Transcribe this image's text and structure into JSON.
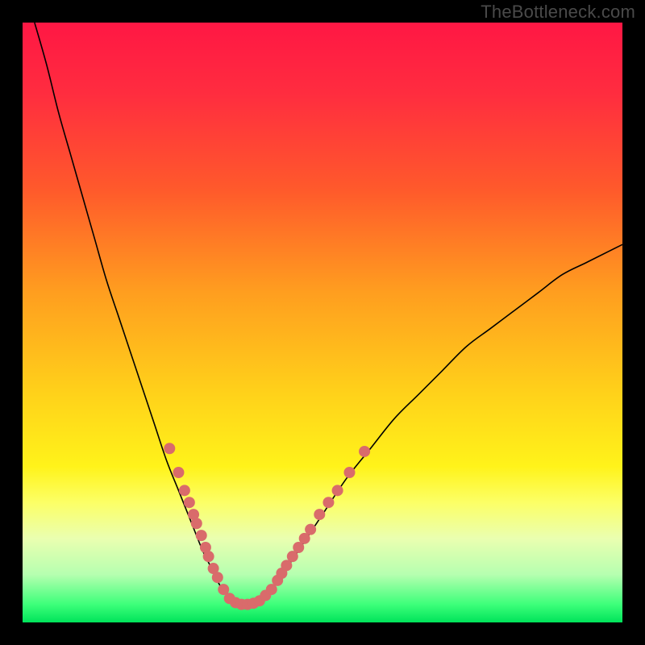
{
  "watermark": "TheBottleneck.com",
  "chart_data": {
    "type": "line",
    "title": "",
    "xlabel": "",
    "ylabel": "",
    "xlim": [
      0,
      100
    ],
    "ylim": [
      0,
      100
    ],
    "background_gradient": {
      "stops": [
        {
          "offset": 0.0,
          "color": "#ff1744"
        },
        {
          "offset": 0.12,
          "color": "#ff2d3f"
        },
        {
          "offset": 0.28,
          "color": "#ff5a2b"
        },
        {
          "offset": 0.45,
          "color": "#ff9e1f"
        },
        {
          "offset": 0.62,
          "color": "#ffd21a"
        },
        {
          "offset": 0.74,
          "color": "#fff31a"
        },
        {
          "offset": 0.8,
          "color": "#fcff66"
        },
        {
          "offset": 0.86,
          "color": "#eaffb0"
        },
        {
          "offset": 0.92,
          "color": "#b6ffb0"
        },
        {
          "offset": 0.97,
          "color": "#3dff7a"
        },
        {
          "offset": 1.0,
          "color": "#00e35a"
        }
      ]
    },
    "series": [
      {
        "name": "curve",
        "stroke": "#000000",
        "stroke_width": 1.6,
        "x": [
          2,
          4,
          6,
          8,
          10,
          12,
          14,
          16,
          18,
          20,
          22,
          24,
          26,
          28,
          30,
          31,
          32,
          33,
          34,
          35,
          36,
          37,
          38,
          39,
          40,
          42,
          44,
          46,
          48,
          50,
          54,
          58,
          62,
          66,
          70,
          74,
          78,
          82,
          86,
          90,
          94,
          98,
          100
        ],
        "y": [
          100,
          93,
          85,
          78,
          71,
          64,
          57,
          51,
          45,
          39,
          33,
          27,
          22,
          17,
          12,
          10,
          8,
          6,
          5,
          4,
          3,
          3,
          3,
          3,
          4,
          6,
          9,
          12,
          15,
          18,
          24,
          29,
          34,
          38,
          42,
          46,
          49,
          52,
          55,
          58,
          60,
          62,
          63
        ]
      }
    ],
    "markers": {
      "color": "#d96b6b",
      "radius": 7,
      "points": [
        {
          "x": 24.5,
          "y": 29
        },
        {
          "x": 26.0,
          "y": 25
        },
        {
          "x": 27.0,
          "y": 22
        },
        {
          "x": 27.8,
          "y": 20
        },
        {
          "x": 28.5,
          "y": 18
        },
        {
          "x": 29.0,
          "y": 16.5
        },
        {
          "x": 29.8,
          "y": 14.5
        },
        {
          "x": 30.5,
          "y": 12.5
        },
        {
          "x": 31.0,
          "y": 11
        },
        {
          "x": 31.8,
          "y": 9
        },
        {
          "x": 32.5,
          "y": 7.5
        },
        {
          "x": 33.5,
          "y": 5.5
        },
        {
          "x": 34.5,
          "y": 4
        },
        {
          "x": 35.5,
          "y": 3.3
        },
        {
          "x": 36.5,
          "y": 3
        },
        {
          "x": 37.5,
          "y": 3
        },
        {
          "x": 38.5,
          "y": 3.2
        },
        {
          "x": 39.5,
          "y": 3.6
        },
        {
          "x": 40.5,
          "y": 4.5
        },
        {
          "x": 41.5,
          "y": 5.5
        },
        {
          "x": 42.5,
          "y": 7
        },
        {
          "x": 43.2,
          "y": 8.2
        },
        {
          "x": 44.0,
          "y": 9.5
        },
        {
          "x": 45.0,
          "y": 11
        },
        {
          "x": 46.0,
          "y": 12.5
        },
        {
          "x": 47.0,
          "y": 14
        },
        {
          "x": 48.0,
          "y": 15.5
        },
        {
          "x": 49.5,
          "y": 18
        },
        {
          "x": 51.0,
          "y": 20
        },
        {
          "x": 52.5,
          "y": 22
        },
        {
          "x": 54.5,
          "y": 25
        },
        {
          "x": 57.0,
          "y": 28.5
        }
      ]
    }
  }
}
